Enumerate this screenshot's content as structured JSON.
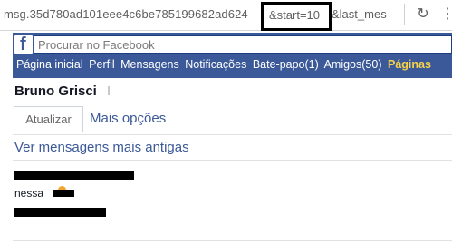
{
  "browser": {
    "url_prefix": "msg.35d780ad101eee4c6be785199682ad624",
    "url_highlight": "&start=10",
    "url_suffix": "&last_mes",
    "reload_icon": "reload-icon",
    "menu_icon": "menu-icon"
  },
  "facebook": {
    "logo_letter": "f",
    "search_placeholder": "Procurar no Facebook",
    "nav": [
      "Página inicial",
      "Perfil",
      "Mensagens",
      "Notificações",
      "Bate-papo(1)",
      "Amigos(50)",
      "Páginas"
    ]
  },
  "conversation": {
    "name": "Bruno Grisci",
    "refresh_label": "Atualizar",
    "more_options_label": "Mais opções",
    "older_messages_label": "Ver mensagens mais antigas",
    "visible_fragment": "nessa"
  },
  "colors": {
    "facebook_blue": "#3b5998",
    "active_nav": "#f7d34a",
    "highlight_border": "#000000"
  }
}
